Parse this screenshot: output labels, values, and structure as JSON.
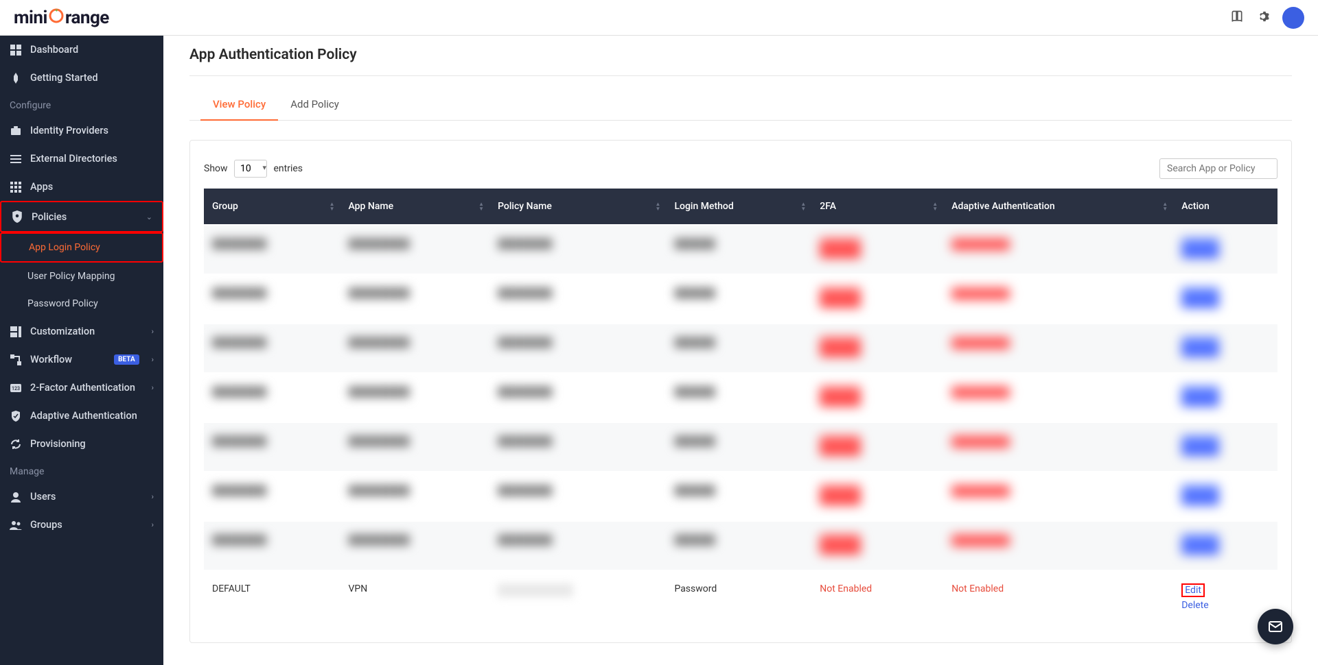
{
  "brand": {
    "pre": "mini",
    "post": "range"
  },
  "sidebar": {
    "dashboard": "Dashboard",
    "getting_started": "Getting Started",
    "heading_configure": "Configure",
    "identity_providers": "Identity Providers",
    "external_directories": "External Directories",
    "apps": "Apps",
    "policies": "Policies",
    "app_login_policy": "App Login Policy",
    "user_policy_mapping": "User Policy Mapping",
    "password_policy": "Password Policy",
    "customization": "Customization",
    "workflow": "Workflow",
    "workflow_badge": "BETA",
    "two_factor": "2-Factor Authentication",
    "adaptive_auth": "Adaptive Authentication",
    "provisioning": "Provisioning",
    "heading_manage": "Manage",
    "users": "Users",
    "groups": "Groups"
  },
  "page": {
    "title": "App Authentication Policy",
    "tabs": {
      "view": "View Policy",
      "add": "Add Policy"
    },
    "show_label": "Show",
    "entries_label": "entries",
    "page_size": "10",
    "search_placeholder": "Search App or Policy"
  },
  "table": {
    "headers": {
      "group": "Group",
      "app_name": "App Name",
      "policy_name": "Policy Name",
      "login_method": "Login Method",
      "two_fa": "2FA",
      "adaptive_auth": "Adaptive Authentication",
      "action": "Action"
    },
    "rows": [
      {
        "blurred": true
      },
      {
        "blurred": true
      },
      {
        "blurred": true
      },
      {
        "blurred": true
      },
      {
        "blurred": true
      },
      {
        "blurred": true
      },
      {
        "blurred": true
      },
      {
        "blurred": false,
        "group": "DEFAULT",
        "app_name": "VPN",
        "policy_name": "",
        "login_method": "Password",
        "two_fa": "Not Enabled",
        "adaptive_auth": "Not Enabled",
        "action_edit": "Edit",
        "action_delete": "Delete"
      }
    ]
  }
}
